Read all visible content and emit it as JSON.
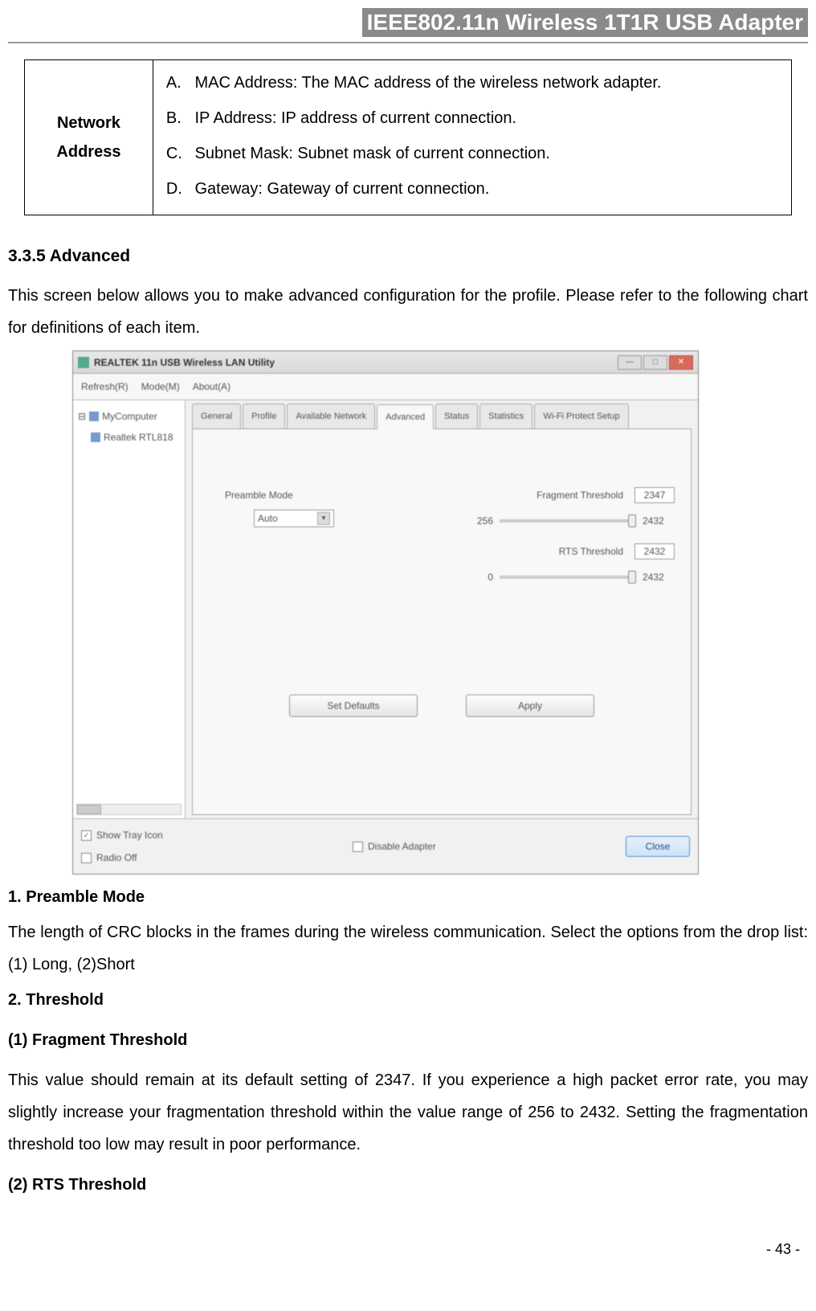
{
  "header": {
    "title": "IEEE802.11n Wireless 1T1R USB Adapter"
  },
  "table": {
    "label_line1": "Network",
    "label_line2": "Address",
    "items": [
      {
        "letter": "A.",
        "text": "MAC Address: The MAC address of the wireless network adapter."
      },
      {
        "letter": "B.",
        "text": "IP Address: IP address of current connection."
      },
      {
        "letter": "C.",
        "text": "Subnet Mask: Subnet mask of current connection."
      },
      {
        "letter": "D.",
        "text": "Gateway: Gateway of current connection."
      }
    ]
  },
  "section": {
    "number_title": "3.3.5  Advanced",
    "intro": "This screen below allows you to make advanced configuration for the profile. Please refer to the following chart for definitions of each item."
  },
  "app": {
    "title": "REALTEK 11n USB Wireless LAN Utility",
    "menus": [
      "Refresh(R)",
      "Mode(M)",
      "About(A)"
    ],
    "tree": {
      "root": "MyComputer",
      "child": "Realtek RTL818"
    },
    "tabs": [
      "General",
      "Profile",
      "Available Network",
      "Advanced",
      "Status",
      "Statistics",
      "Wi-Fi Protect Setup"
    ],
    "active_tab": "Advanced",
    "preamble_label": "Preamble Mode",
    "preamble_value": "Auto",
    "fragment": {
      "label": "Fragment Threshold",
      "value": "2347",
      "min": "256",
      "max": "2432"
    },
    "rts": {
      "label": "RTS Threshold",
      "value": "2432",
      "min": "0",
      "max": "2432"
    },
    "buttons": {
      "defaults": "Set Defaults",
      "apply": "Apply"
    },
    "bottom": {
      "show_tray": "Show Tray Icon",
      "radio_off": "Radio Off",
      "disable_adapter": "Disable Adapter",
      "close": "Close"
    }
  },
  "descriptions": {
    "h1": "1. Preamble Mode",
    "p1": "The length of CRC blocks in the frames during the wireless communication. Select the options from the drop list: (1) Long, (2)Short",
    "h2": "2. Threshold",
    "h2a": "(1) Fragment Threshold",
    "p2a": "This value should remain at its default setting of 2347. If you experience a high packet error rate, you may slightly increase your fragmentation threshold within the value range of 256 to 2432. Setting the fragmentation threshold too low may result in poor performance.",
    "h2b": "(2) RTS Threshold"
  },
  "footer": {
    "page": "- 43 -"
  }
}
